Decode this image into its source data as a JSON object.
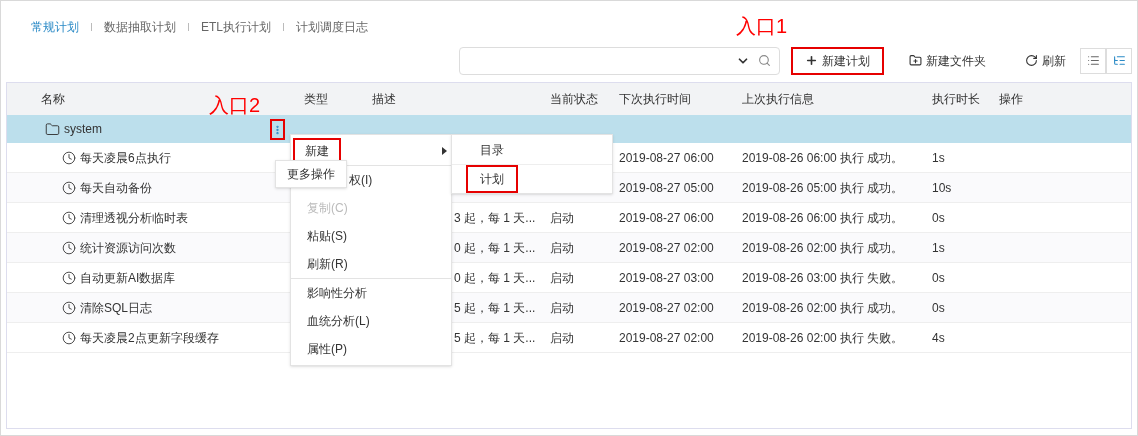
{
  "tabs": [
    {
      "label": "常规计划",
      "selected": true
    },
    {
      "label": "数据抽取计划",
      "selected": false
    },
    {
      "label": "ETL执行计划",
      "selected": false
    },
    {
      "label": "计划调度日志",
      "selected": false
    }
  ],
  "toolbar": {
    "buttons": [
      {
        "kind": "plus",
        "label": "新建计划",
        "highlighted": true,
        "annotation": "入口1"
      },
      {
        "kind": "folder",
        "label": "新建文件夹",
        "highlighted": false
      },
      {
        "kind": "refresh",
        "label": "刷新",
        "highlighted": false
      }
    ],
    "view_toggles": [
      {
        "kind": "list",
        "selected": false
      },
      {
        "kind": "tree",
        "selected": true
      }
    ]
  },
  "table": {
    "columns": [
      "名称",
      "类型",
      "描述",
      "当前状态",
      "下次执行时间",
      "上次执行信息",
      "执行时长",
      "操作"
    ],
    "folder": {
      "name": "system",
      "selected": true,
      "more_button": {
        "highlighted": true,
        "annotation": "入口2"
      },
      "tooltip": "更多操作"
    },
    "rows": [
      {
        "name": "每天凌晨6点执行",
        "next_run": "2019-08-27 06:00",
        "last_run": "2019-08-26 06:00 执行 成功。",
        "duration": "1s"
      },
      {
        "name": "每天自动备份",
        "next_run": "2019-08-27 05:00",
        "last_run": "2019-08-26 05:00 执行 成功。",
        "duration": "10s"
      },
      {
        "name": "清理透视分析临时表",
        "description": "3 起，每 1 天...",
        "status": "启动",
        "next_run": "2019-08-27 06:00",
        "last_run": "2019-08-26 06:00 执行 成功。",
        "duration": "0s"
      },
      {
        "name": "统计资源访问次数",
        "description": "0 起，每 1 天...",
        "status": "启动",
        "next_run": "2019-08-27 02:00",
        "last_run": "2019-08-26 02:00 执行 成功。",
        "duration": "1s"
      },
      {
        "name": "自动更新AI数据库",
        "description": "0 起，每 1 天...",
        "status": "启动",
        "next_run": "2019-08-27 03:00",
        "last_run": "2019-08-26 03:00 执行 失败。",
        "duration": "0s"
      },
      {
        "name": "清除SQL日志",
        "description": "5 起，每 1 天...",
        "status": "启动",
        "next_run": "2019-08-27 02:00",
        "last_run": "2019-08-26 02:00 执行 成功。",
        "duration": "0s"
      },
      {
        "name": "每天凌晨2点更新字段缓存",
        "description": "5 起，每 1 天...",
        "status": "启动",
        "next_run": "2019-08-27 02:00",
        "last_run": "2019-08-26 02:00 执行 失败。",
        "duration": "4s"
      }
    ]
  },
  "context_menu": {
    "items": [
      {
        "kind": "submenu",
        "label": "新建",
        "disabled": false,
        "highlighted": true
      },
      {
        "kind": "divider"
      },
      {
        "kind": "action",
        "label": "权(I)",
        "disabled": false,
        "highlighted": false
      },
      {
        "kind": "action",
        "label": "复制(C)",
        "disabled": true,
        "highlighted": false
      },
      {
        "kind": "action",
        "label": "粘贴(S)",
        "disabled": false,
        "highlighted": false
      },
      {
        "kind": "action",
        "label": "刷新(R)",
        "disabled": false,
        "highlighted": false
      },
      {
        "kind": "divider"
      },
      {
        "kind": "action",
        "label": "影响性分析",
        "disabled": false,
        "highlighted": false
      },
      {
        "kind": "action",
        "label": "血统分析(L)",
        "disabled": false,
        "highlighted": false
      },
      {
        "kind": "action",
        "label": "属性(P)",
        "disabled": false,
        "highlighted": false
      }
    ],
    "submenu": [
      {
        "label": "目录",
        "highlighted": false
      },
      {
        "label": "计划",
        "highlighted": true
      }
    ]
  }
}
